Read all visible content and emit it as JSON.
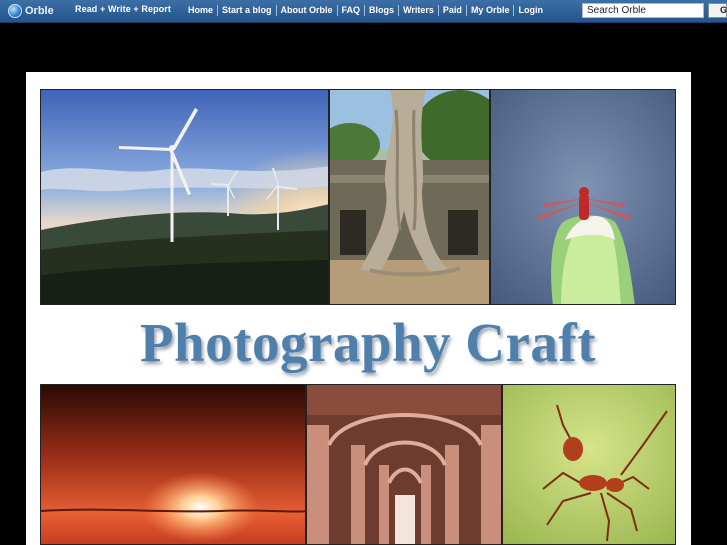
{
  "topbar": {
    "brand": "Orble",
    "tagline": "Read + Write + Report",
    "nav": [
      "Home",
      "Start a blog",
      "About Orble",
      "FAQ",
      "Blogs",
      "Writers",
      "Paid",
      "My Orble",
      "Login"
    ],
    "search_placeholder": "Search Orble",
    "search_button": "G",
    "colors": {
      "bar": "#2c5f96",
      "text": "#ffffff"
    }
  },
  "header": {
    "title": "Photography Craft",
    "title_color": "#4f7fab"
  },
  "photos": [
    {
      "name": "wind-turbines",
      "subject": "wind turbines at sunset"
    },
    {
      "name": "temple-tree",
      "subject": "tree roots over temple ruins"
    },
    {
      "name": "dragonfly",
      "subject": "red dragonfly on a bud"
    },
    {
      "name": "sunset",
      "subject": "red sunset"
    },
    {
      "name": "arches",
      "subject": "red sandstone arches"
    },
    {
      "name": "ant",
      "subject": "red ant on green"
    }
  ]
}
